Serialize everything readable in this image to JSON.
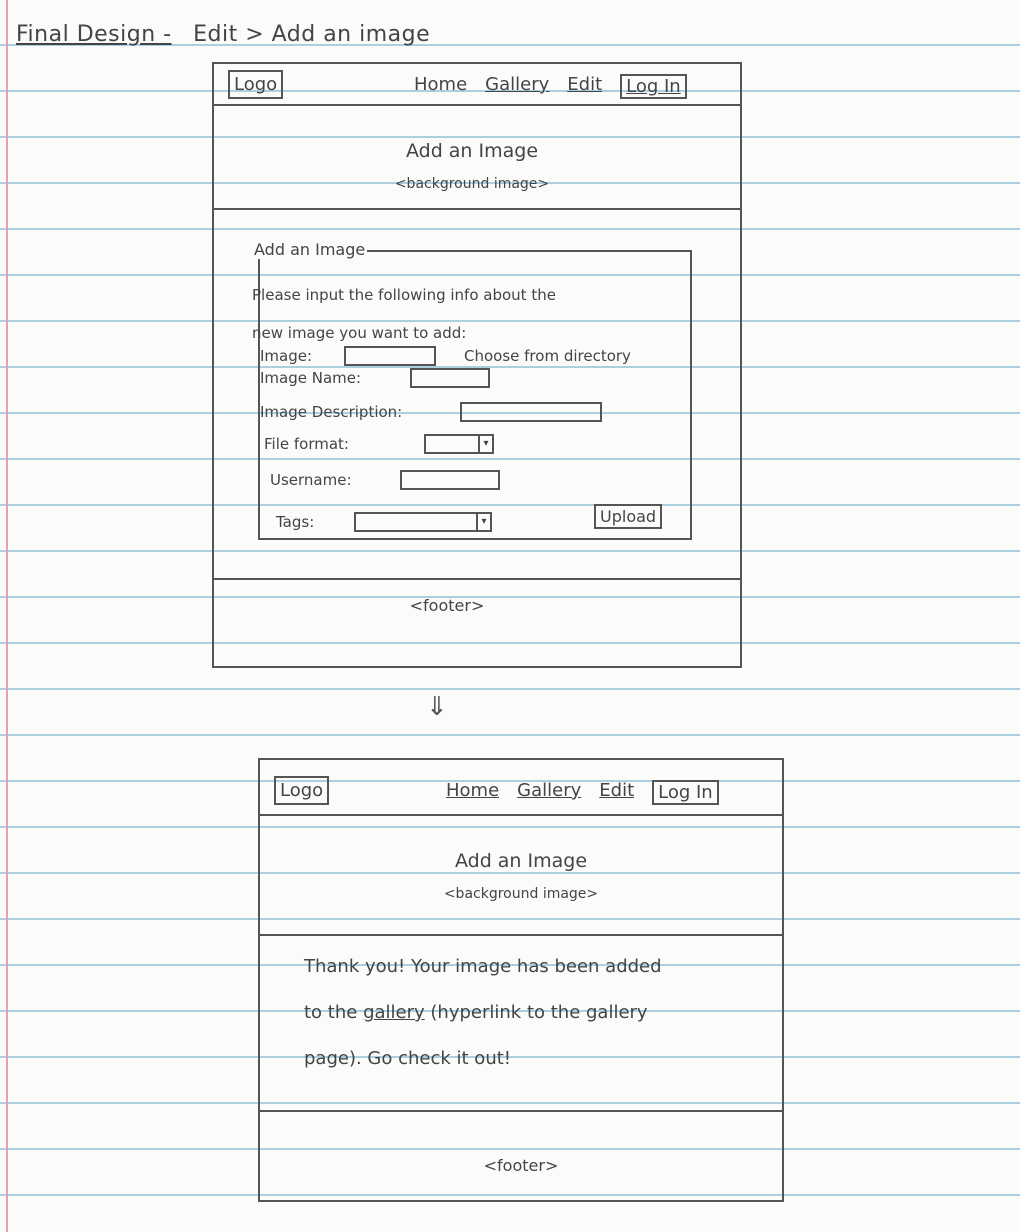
{
  "page_title": {
    "prefix": "Final Design -",
    "path": "Edit > Add an image"
  },
  "colors": {
    "ink": "#555555",
    "notebook_line": "#a9cfe0",
    "margin_line": "#e3a4b0",
    "paper": "#fbfbf9"
  },
  "mockup1": {
    "logo": "Logo",
    "nav": [
      "Home",
      "Gallery",
      "Edit",
      "Log In"
    ],
    "hero_title": "Add an Image",
    "hero_sub": "<background image>",
    "form": {
      "legend": "Add an Image",
      "instructions_line1": "Please input the following info about the",
      "instructions_line2": "new image you want to add:",
      "image_label": "Image:",
      "choose_label": "Choose from directory",
      "name_label": "Image Name:",
      "description_label": "Image Description:",
      "format_label": "File format:",
      "username_label": "Username:",
      "tags_label": "Tags:",
      "upload_button": "Upload"
    },
    "footer": "<footer>"
  },
  "arrow": "⇓",
  "mockup2": {
    "logo": "Logo",
    "nav": [
      "Home",
      "Gallery",
      "Edit",
      "Log In"
    ],
    "hero_title": "Add an Image",
    "hero_sub": "<background image>",
    "message_line1": "Thank you! Your image has been added",
    "message_line2_pre": "to the",
    "message_link": "gallery",
    "message_line2_post": "(hyperlink to the gallery",
    "message_line3": "page). Go check it out!",
    "footer": "<footer>"
  }
}
